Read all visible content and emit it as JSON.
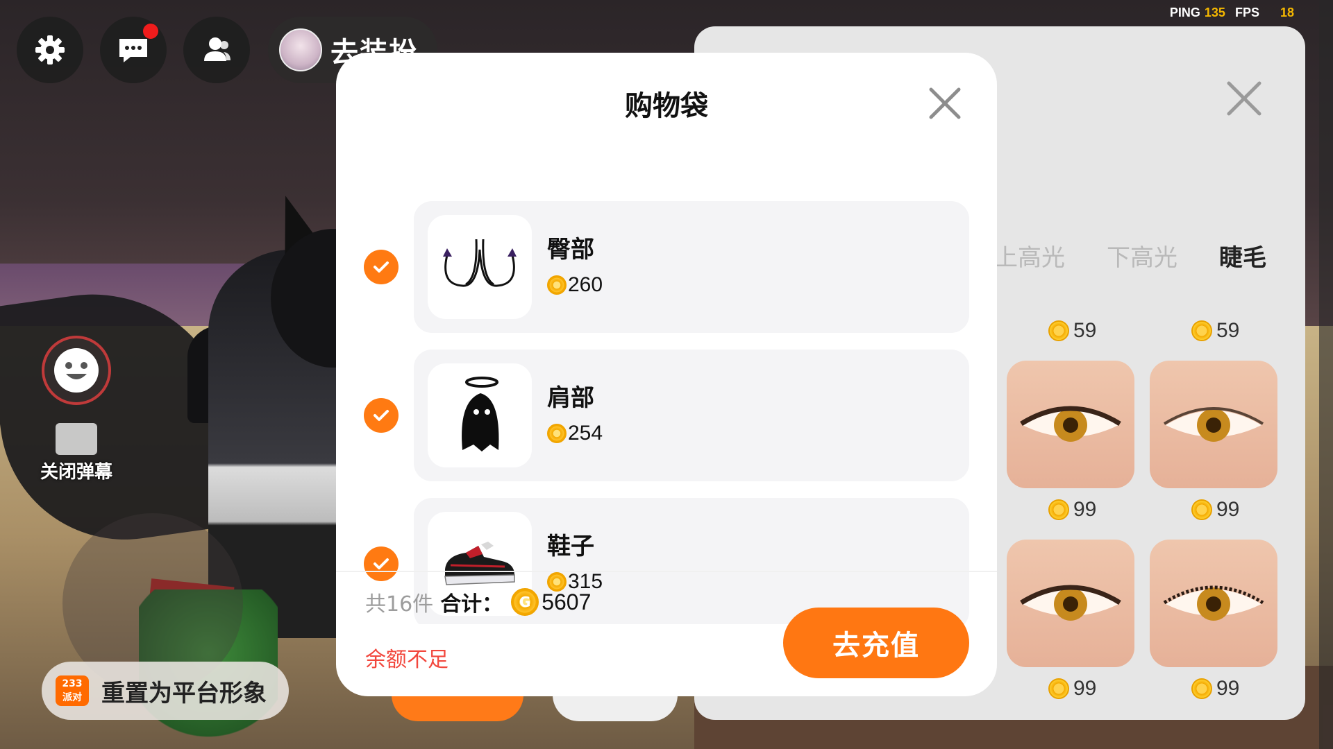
{
  "stats": {
    "ping_label": "PING",
    "ping_value": "135",
    "fps_label": "FPS",
    "fps_value": "18"
  },
  "hud": {
    "settings_icon": "gear-icon",
    "chat_icon": "chat-bubble-icon",
    "friends_icon": "friends-icon",
    "dressup_label": "去装扮"
  },
  "left_controls": {
    "emoji_icon": "smiley-icon",
    "danmu_label": "关闭弹幕",
    "reset_logo": "233\n派对",
    "reset_label": "重置为平台形象"
  },
  "shop_panel": {
    "tabs": [
      "上高光",
      "下高光",
      "睫毛"
    ],
    "active_tab": "睫毛",
    "prices": [
      "59",
      "59",
      "99",
      "99",
      "99",
      "99"
    ]
  },
  "dialog": {
    "title": "购物袋",
    "items": [
      {
        "name": "臀部",
        "price": "260",
        "checked": true,
        "thumb": "tail-icon"
      },
      {
        "name": "肩部",
        "price": "254",
        "checked": true,
        "thumb": "ghost-halo-icon"
      },
      {
        "name": "鞋子",
        "price": "315",
        "checked": true,
        "thumb": "sneakers-icon"
      }
    ],
    "count_label": "共16件",
    "total_label": "合计：",
    "total_value": "5607",
    "insufficient_label": "余额不足",
    "recharge_label": "去充值"
  },
  "colors": {
    "accent": "#ff7712",
    "warning": "#f2473d",
    "coin": "#f4a900",
    "stat_value": "#f5b800"
  }
}
